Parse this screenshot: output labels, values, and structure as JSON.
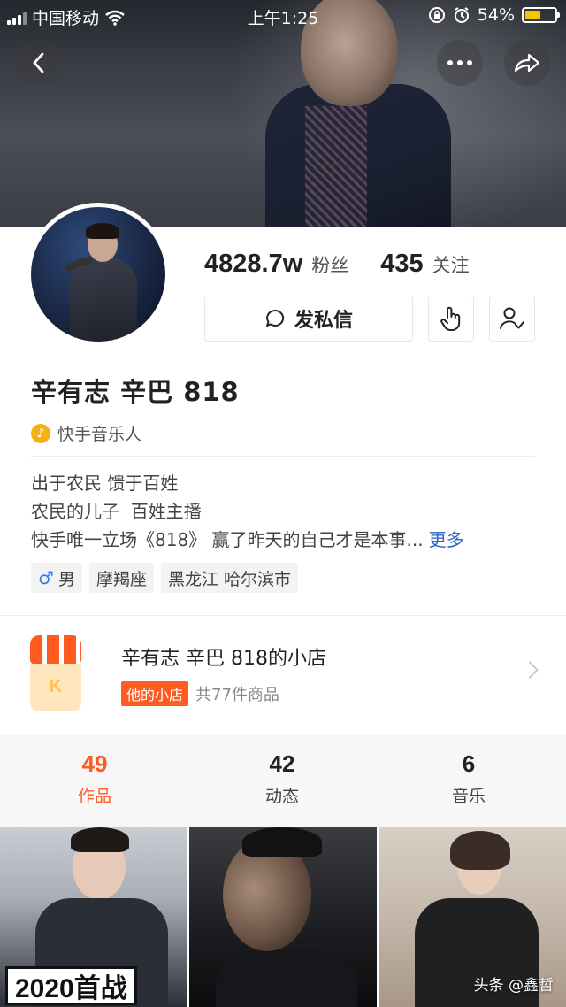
{
  "status_bar": {
    "carrier": "中国移动",
    "time": "上午1:25",
    "battery": "54%",
    "battery_level": 0.54
  },
  "profile": {
    "fans_count": "4828.7w",
    "fans_label": "粉丝",
    "following_count": "435",
    "following_label": "关注",
    "message_button": "发私信",
    "name": "辛有志 辛巴 818",
    "tag": "快手音乐人",
    "bio": [
      "出于农民 馈于百姓",
      "农民的儿子  百姓主播",
      "快手唯一立场《818》 赢了昨天的自己才是本事..."
    ],
    "more_label": "更多",
    "chips": {
      "gender": "男",
      "zodiac": "摩羯座",
      "location": "黑龙江 哈尔滨市"
    }
  },
  "shop": {
    "title": "辛有志 辛巴 818的小店",
    "badge": "他的小店",
    "count_text": "共77件商品"
  },
  "tabs": [
    {
      "count": "49",
      "label": "作品",
      "active": true
    },
    {
      "count": "42",
      "label": "动态",
      "active": false
    },
    {
      "count": "6",
      "label": "音乐",
      "active": false
    }
  ],
  "grid": {
    "first_caption": "2020首战"
  },
  "watermark": "头条 @鑫哲",
  "colors": {
    "accent": "#ff5a1f",
    "link": "#2a64c8",
    "battery": "#f5c400"
  }
}
